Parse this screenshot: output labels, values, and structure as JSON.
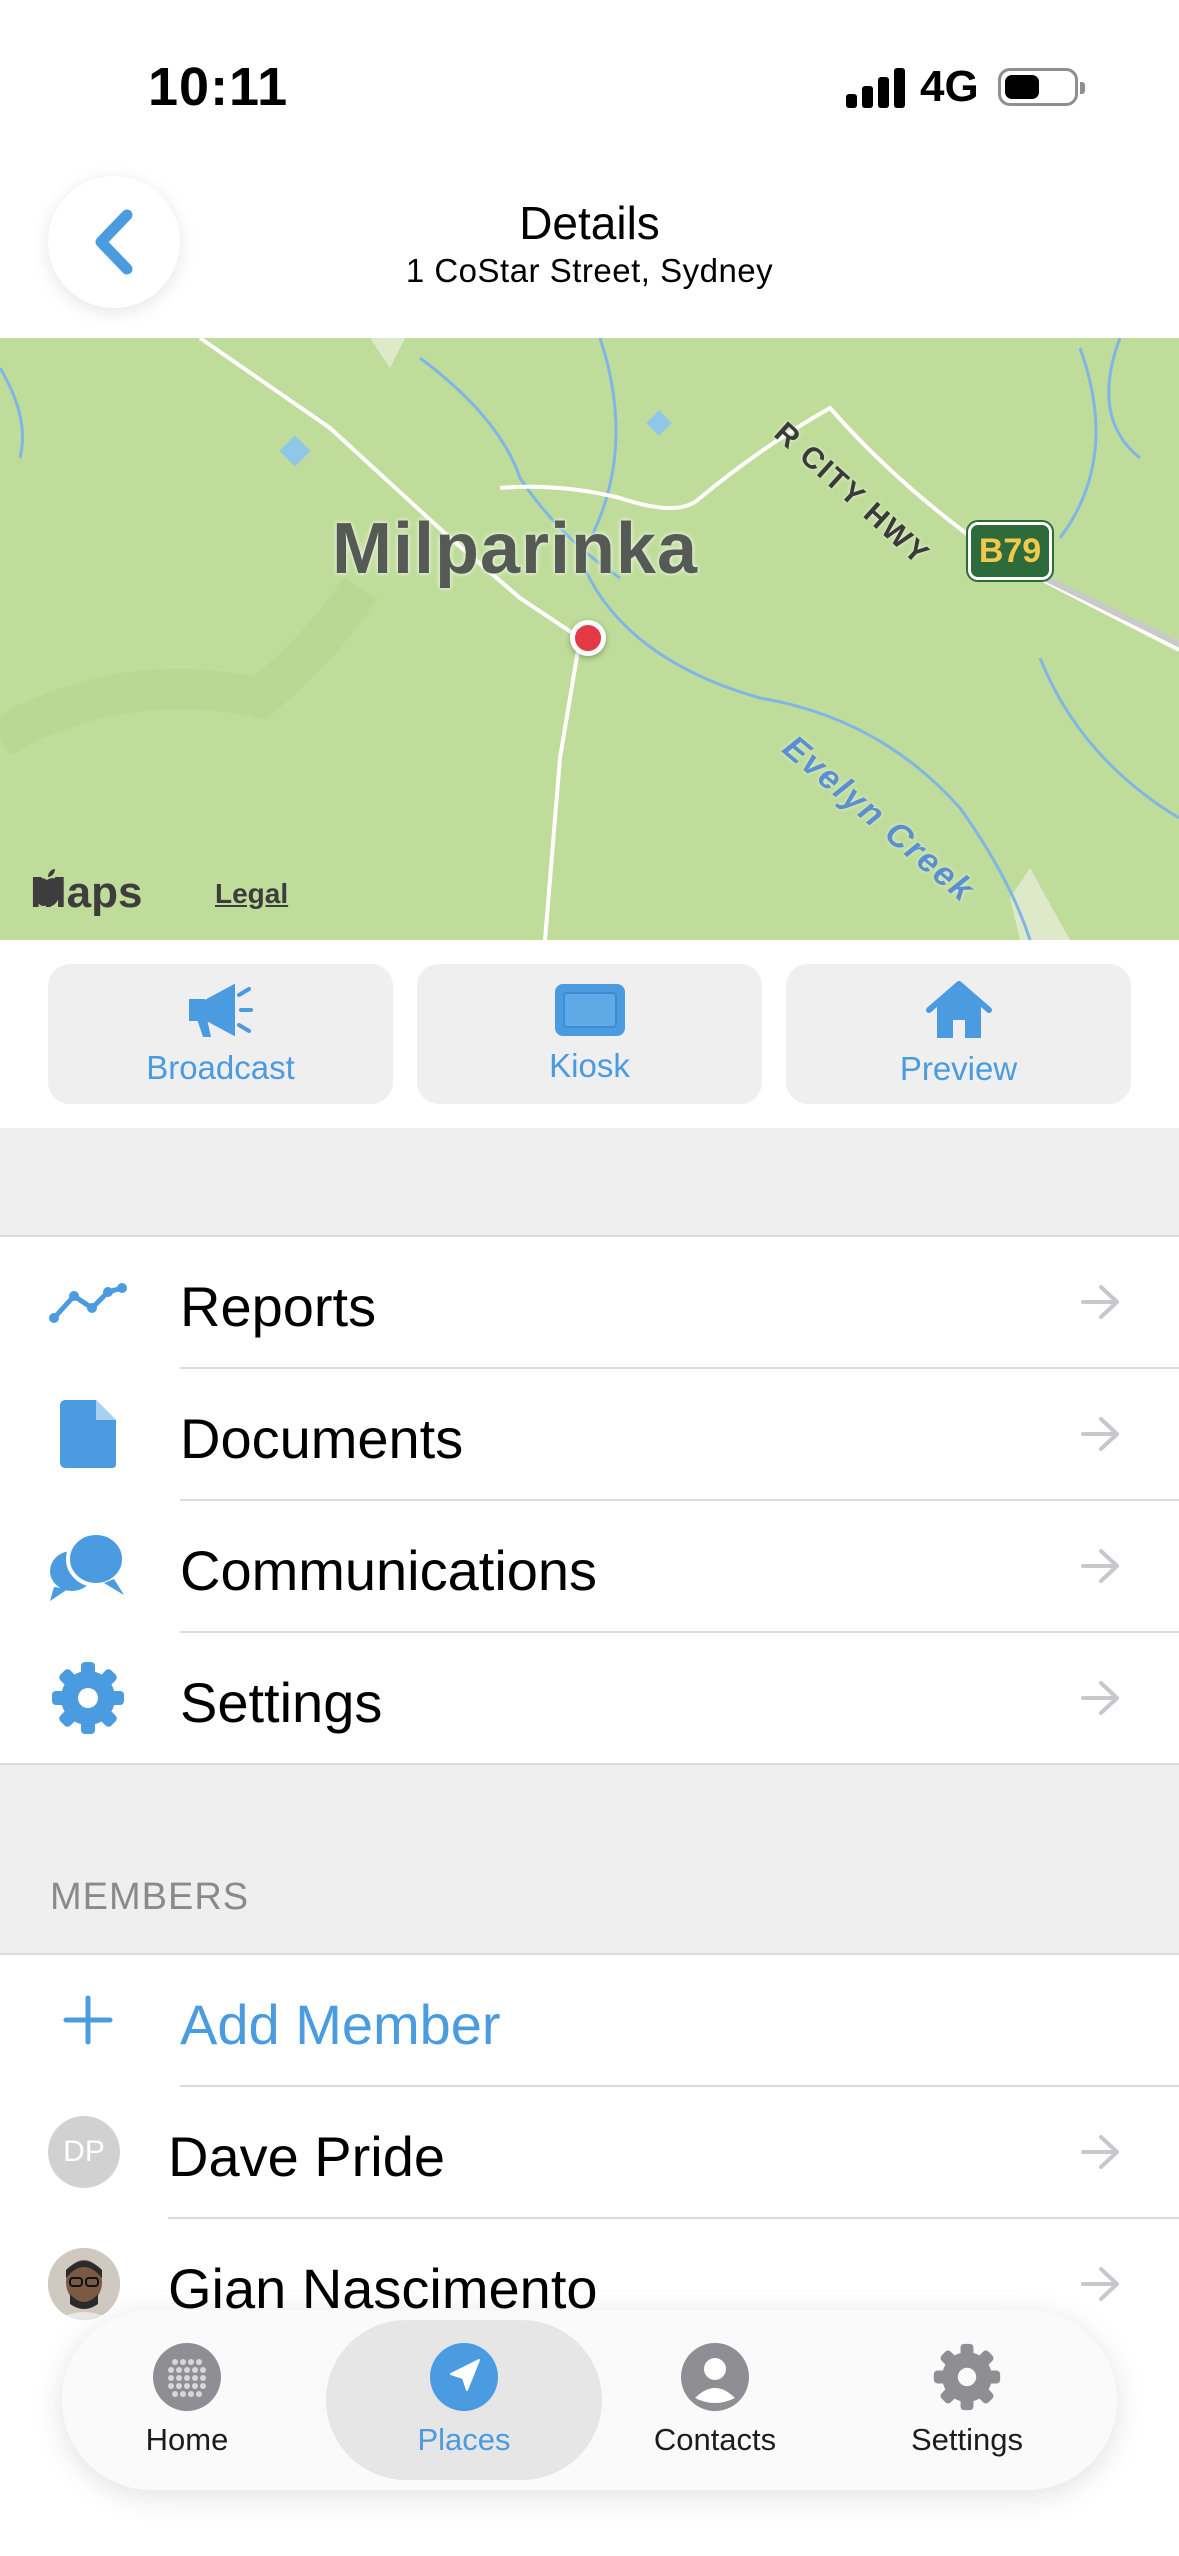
{
  "status_bar": {
    "time": "10:11",
    "network": "4G"
  },
  "header": {
    "title": "Details",
    "subtitle": "1 CoStar Street, Sydney"
  },
  "map": {
    "town": "Milparinka",
    "highway": "R CITY HWY",
    "route_shield": "B79",
    "creek": "Evelyn Creek",
    "brand": "Maps",
    "legal": "Legal"
  },
  "actions": [
    {
      "label": "Broadcast",
      "icon": "megaphone-icon"
    },
    {
      "label": "Kiosk",
      "icon": "kiosk-screen-icon"
    },
    {
      "label": "Preview",
      "icon": "house-icon"
    }
  ],
  "menu": [
    {
      "label": "Reports",
      "icon": "chart-line-icon"
    },
    {
      "label": "Documents",
      "icon": "document-icon"
    },
    {
      "label": "Communications",
      "icon": "chat-bubbles-icon"
    },
    {
      "label": "Settings",
      "icon": "gear-icon"
    }
  ],
  "members": {
    "header": "MEMBERS",
    "add_label": "Add Member",
    "list": [
      {
        "name": "Dave Pride",
        "initials": "DP"
      },
      {
        "name": "Gian Nascimento",
        "initials": ""
      }
    ]
  },
  "tabs": [
    {
      "label": "Home",
      "icon": "home-dots-icon",
      "active": false
    },
    {
      "label": "Places",
      "icon": "location-arrow-icon",
      "active": true
    },
    {
      "label": "Contacts",
      "icon": "person-icon",
      "active": false
    },
    {
      "label": "Settings",
      "icon": "gear-icon",
      "active": false
    }
  ],
  "colors": {
    "accent": "#4a9be0",
    "pin": "#e53945",
    "map_land": "#bfdc9a"
  }
}
